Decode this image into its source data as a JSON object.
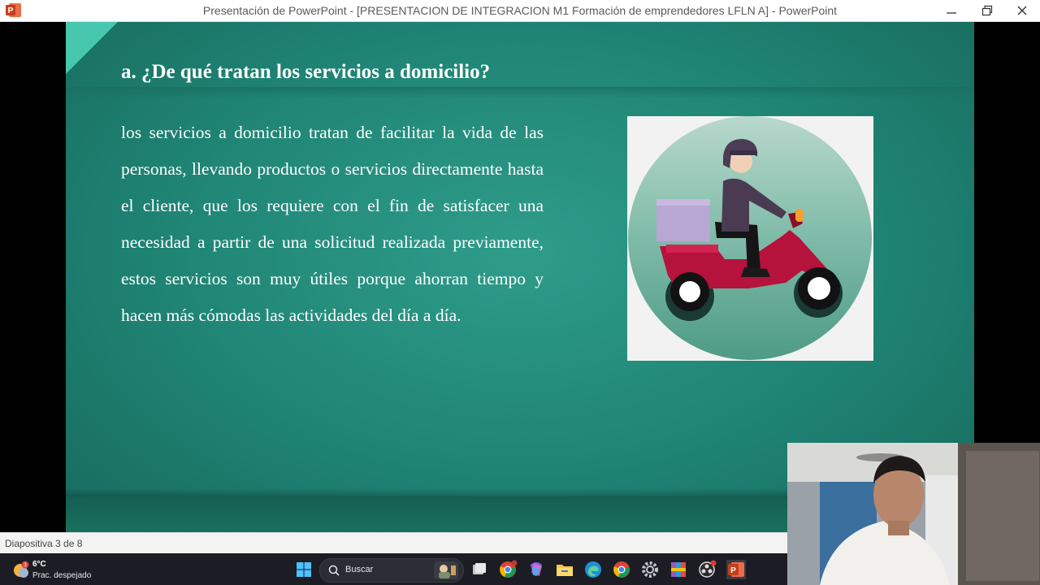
{
  "window": {
    "title": "Presentación de PowerPoint - [PRESENTACION DE INTEGRACION M1 Formación de emprendedores LFLN A] - PowerPoint",
    "app_icon": "powerpoint-icon",
    "controls": [
      "minimize-icon",
      "restore-icon",
      "close-icon"
    ]
  },
  "slide": {
    "title": "a. ¿De qué tratan los servicios a domicilio?",
    "body": "los servicios a domicilio tratan de facilitar la vida de las personas, llevando productos o servicios directamente hasta el cliente, que los requiere con el fin de satisfacer una necesidad a partir de una solicitud realizada previamente, estos servicios son muy útiles porque ahorran tiempo y hacen más cómodas las actividades del día a día.",
    "image": "delivery-scooter-illustration",
    "colors": {
      "background": "#1f8474",
      "accent": "#4dd0b6",
      "text": "#ffffff"
    }
  },
  "status": {
    "slide_counter": "Diapositiva 3 de 8"
  },
  "taskbar": {
    "weather": {
      "temp": "6°C",
      "desc": "Prac. despejado",
      "badge": "3"
    },
    "search_label": "Buscar",
    "apps": [
      "windows-start-icon",
      "task-view-icon",
      "chrome-icon",
      "copilot-icon",
      "file-explorer-icon",
      "edge-icon",
      "chrome-icon",
      "settings-icon",
      "winrar-icon",
      "obs-icon",
      "powerpoint-icon"
    ]
  },
  "webcam": {
    "content": "presenter-video"
  }
}
